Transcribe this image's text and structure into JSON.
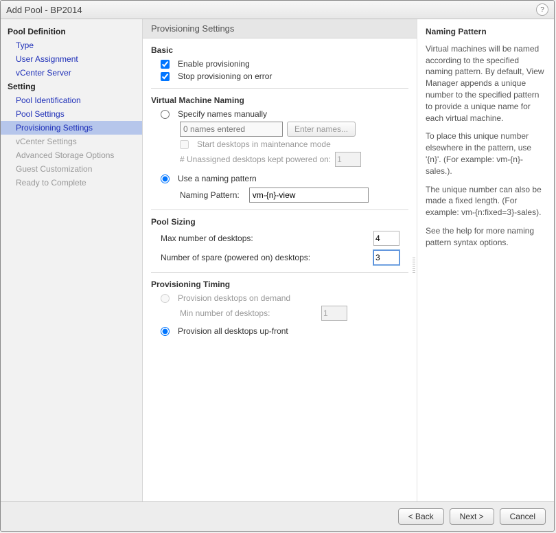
{
  "title": "Add Pool - BP2014",
  "sidebar": {
    "groups": [
      {
        "header": "Pool Definition",
        "items": [
          {
            "label": "Type",
            "state": "link"
          },
          {
            "label": "User Assignment",
            "state": "link"
          },
          {
            "label": "vCenter Server",
            "state": "link"
          }
        ]
      },
      {
        "header": "Setting",
        "items": [
          {
            "label": "Pool Identification",
            "state": "link"
          },
          {
            "label": "Pool Settings",
            "state": "link"
          },
          {
            "label": "Provisioning Settings",
            "state": "selected"
          },
          {
            "label": "vCenter Settings",
            "state": "disabled"
          },
          {
            "label": "Advanced Storage Options",
            "state": "disabled"
          },
          {
            "label": "Guest Customization",
            "state": "disabled"
          },
          {
            "label": "Ready to Complete",
            "state": "disabled"
          }
        ]
      }
    ]
  },
  "content": {
    "header": "Provisioning Settings",
    "basic": {
      "title": "Basic",
      "enable_label": "Enable provisioning",
      "enable_checked": true,
      "stop_label": "Stop provisioning on error",
      "stop_checked": true
    },
    "naming": {
      "title": "Virtual Machine Naming",
      "specify_label": "Specify names manually",
      "names_placeholder": "0 names entered",
      "enter_names_btn": "Enter names...",
      "start_maint_label": "Start desktops in maintenance mode",
      "unassigned_label": "# Unassigned desktops kept powered on:",
      "unassigned_value": "1",
      "use_pattern_label": "Use a naming pattern",
      "pattern_label": "Naming Pattern:",
      "pattern_value": "vm-{n}-view"
    },
    "sizing": {
      "title": "Pool Sizing",
      "max_label": "Max number of desktops:",
      "max_value": "4",
      "spare_label": "Number of spare (powered on) desktops:",
      "spare_value": "3"
    },
    "timing": {
      "title": "Provisioning Timing",
      "ondemand_label": "Provision desktops on demand",
      "min_label": "Min number of desktops:",
      "min_value": "1",
      "upfront_label": "Provision all desktops up-front"
    }
  },
  "help": {
    "title": "Naming Pattern",
    "p1": "Virtual machines will be named according to the specified naming pattern. By default, View Manager appends a unique number to the specified pattern to provide a unique name for each virtual machine.",
    "p2": "To place this unique number elsewhere in the pattern, use '{n}'. (For example: vm-{n}-sales.).",
    "p3": "The unique number can also be made a fixed length. (For example: vm-{n:fixed=3}-sales).",
    "p4": "See the help for more naming pattern syntax options."
  },
  "footer": {
    "back": "< Back",
    "next": "Next >",
    "cancel": "Cancel"
  }
}
